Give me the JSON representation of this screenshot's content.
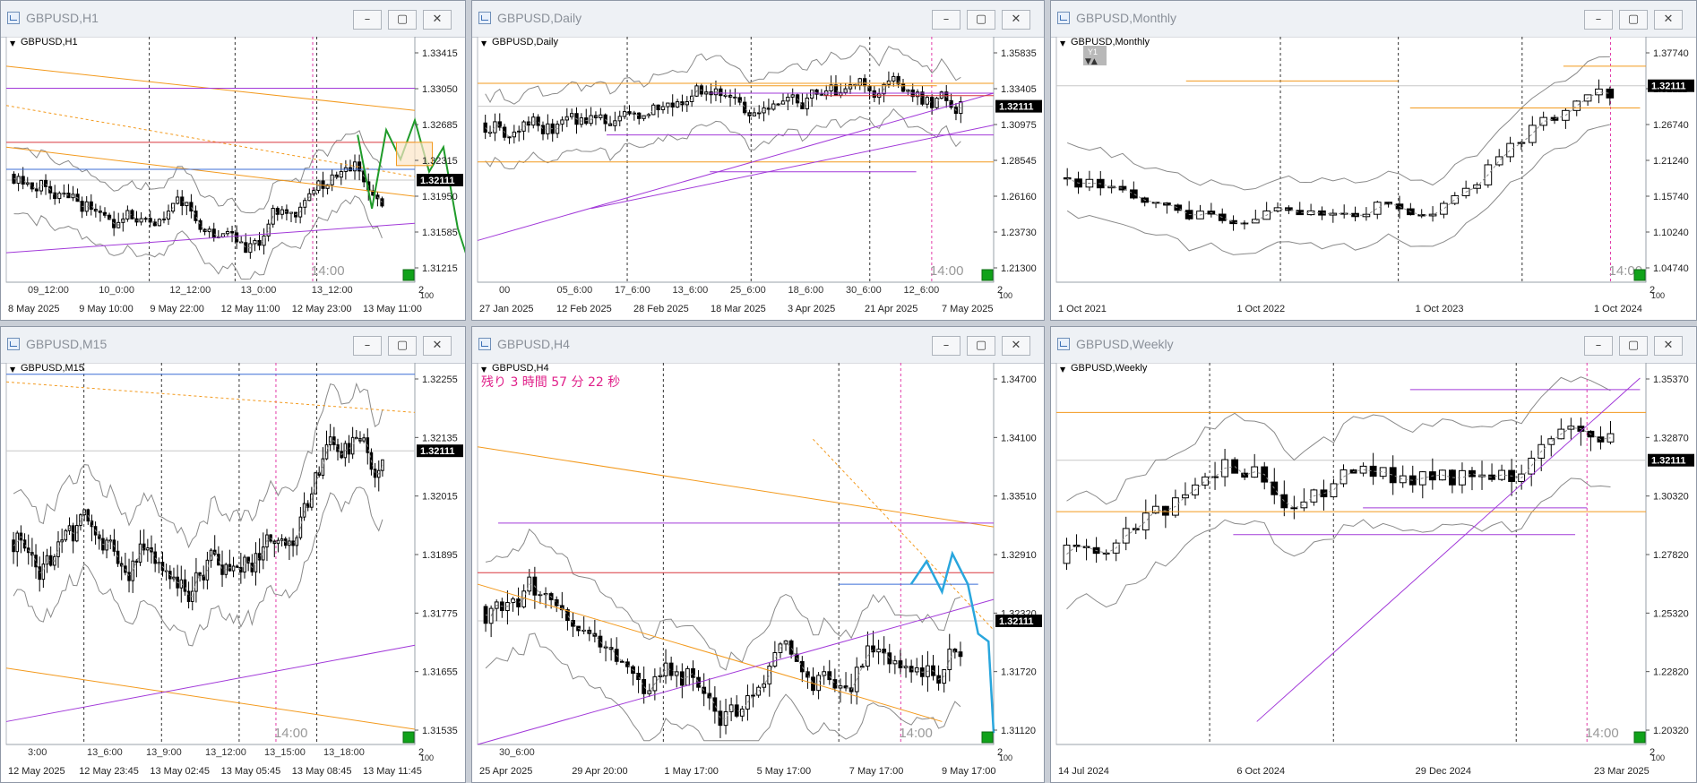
{
  "colors": {
    "bb": "#8a8a8a",
    "orange": "#f39a1e",
    "purple": "#a23ad9",
    "red": "#d9363e",
    "blue": "#3b6ed6",
    "green_arrow": "#1f9b2a",
    "blue_arrow": "#29a6dd",
    "price_tag": "#000000"
  },
  "countdown": "残り 3 時間 57 分 22 秒",
  "windows": [
    {
      "id": "h1",
      "title": "GBPUSD,H1",
      "chart_label": "GBPUSD,H1",
      "price_tag": "1.32111",
      "session_label": "14:00",
      "corner_label": "2",
      "corner_label_2": "100",
      "chart_data": {
        "type": "candlestick",
        "ylim": [
          1.3105,
          1.336
        ],
        "y_ticks": [
          "1.33415",
          "1.33050",
          "1.32685",
          "1.32315",
          "1.31950",
          "1.31585",
          "1.31215"
        ],
        "x_labels": [
          "8 May 2025",
          "9 May 10:00",
          "9 May 22:00",
          "12 May 11:00",
          "12 May 23:00",
          "13 May 11:00"
        ],
        "session_labels": [
          "09_12:00",
          "10_0:00",
          "12_12:00",
          "13_0:00",
          "13_12:00"
        ],
        "last_price": 1.32111
      }
    },
    {
      "id": "daily",
      "title": "GBPUSD,Daily",
      "chart_label": "GBPUSD,Daily",
      "price_tag": "1.32111",
      "session_label": "14:00",
      "corner_label": "2",
      "corner_label_2": "100",
      "chart_data": {
        "type": "candlestick",
        "ylim": [
          1.205,
          1.367
        ],
        "y_ticks": [
          "1.35835",
          "1.33405",
          "1.30975",
          "1.28545",
          "1.26160",
          "1.23730",
          "1.21300"
        ],
        "x_labels": [
          "27 Jan 2025",
          "12 Feb 2025",
          "28 Feb 2025",
          "18 Mar 2025",
          "3 Apr 2025",
          "21 Apr 2025",
          "7 May 2025"
        ],
        "session_labels": [
          "00",
          "05_6:00",
          "17_6:00",
          "13_6:00",
          "25_6:00",
          "18_6:00",
          "30_6:00",
          "12_6:00"
        ],
        "last_price": 1.32111
      }
    },
    {
      "id": "monthly",
      "title": "GBPUSD,Monthly",
      "chart_label": "GBPUSD,Monthly",
      "price_tag": "1.32111",
      "session_label": "14:00",
      "corner_label": "2",
      "corner_label_2": "100",
      "badge": "Y1",
      "chart_data": {
        "type": "candlestick",
        "ylim": [
          1.025,
          1.395
        ],
        "y_ticks": [
          "1.37740",
          "1.32111",
          "1.26740",
          "1.21240",
          "1.15740",
          "1.10240",
          "1.04740"
        ],
        "x_labels": [
          "1 Oct 2021",
          "1 Oct 2022",
          "1 Oct 2023",
          "1 Oct 2024"
        ],
        "last_price": 1.32111
      }
    },
    {
      "id": "m15",
      "title": "GBPUSD,M15",
      "chart_label": "GBPUSD,M15",
      "price_tag": "1.32111",
      "session_label": "14:00",
      "corner_label": "2",
      "corner_label_2": "100",
      "chart_data": {
        "type": "candlestick",
        "ylim": [
          1.3148,
          1.323
        ],
        "y_ticks": [
          "1.32255",
          "1.32135",
          "1.32015",
          "1.31895",
          "1.31775",
          "1.31655",
          "1.31535"
        ],
        "x_labels": [
          "12 May 2025",
          "12 May 23:45",
          "13 May 02:45",
          "13 May 05:45",
          "13 May 08:45",
          "13 May 11:45"
        ],
        "session_labels": [
          "3:00",
          "13_6:00",
          "13_9:00",
          "13_12:00",
          "13_15:00",
          "13_18:00"
        ],
        "last_price": 1.32111
      }
    },
    {
      "id": "h4",
      "title": "GBPUSD,H4",
      "chart_label": "GBPUSD,H4",
      "price_tag": "1.32111",
      "session_label": "14:00",
      "corner_label": "2",
      "corner_label_2": "100",
      "chart_data": {
        "type": "candlestick",
        "ylim": [
          1.3075,
          1.3495
        ],
        "y_ticks": [
          "1.34700",
          "1.34100",
          "1.33510",
          "1.32910",
          "1.32320",
          "1.31720",
          "1.31120"
        ],
        "x_labels": [
          "25 Apr 2025",
          "29 Apr 20:00",
          "1 May 17:00",
          "5 May 17:00",
          "7 May 17:00",
          "9 May 17:00"
        ],
        "session_labels": [
          "30_6:00"
        ],
        "last_price": 1.32111
      }
    },
    {
      "id": "weekly",
      "title": "GBPUSD,Weekly",
      "chart_label": "GBPUSD,Weekly",
      "price_tag": "1.32111",
      "session_label": "14:00",
      "corner_label": "2",
      "corner_label_2": "100",
      "chart_data": {
        "type": "candlestick",
        "ylim": [
          1.193,
          1.365
        ],
        "y_ticks": [
          "1.35370",
          "1.32870",
          "1.30320",
          "1.27820",
          "1.25320",
          "1.22820",
          "1.20320"
        ],
        "x_labels": [
          "14 Jul 2024",
          "6 Oct 2024",
          "29 Dec 2024",
          "23 Mar 2025"
        ],
        "last_price": 1.32111
      }
    }
  ]
}
